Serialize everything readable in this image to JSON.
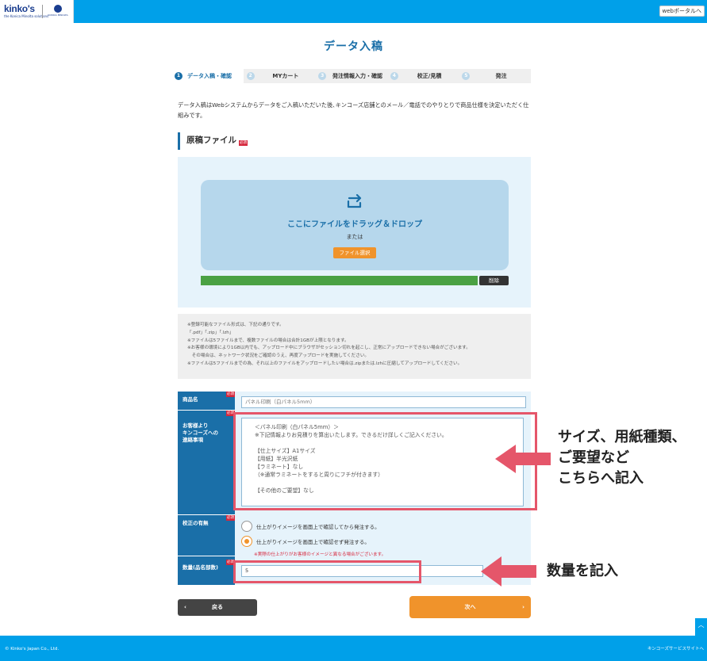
{
  "header": {
    "logo_text": "kinko's",
    "logo_sub": "the Konica Minolta solutions",
    "logo_partner": "KONICA MINOLTA",
    "web_button": "webポータルへ"
  },
  "page_title": "データ入稿",
  "steps": [
    {
      "num": "1",
      "label": "データ入稿・確認"
    },
    {
      "num": "2",
      "label": "MYカート"
    },
    {
      "num": "3",
      "label": "発注情報入力・確認"
    },
    {
      "num": "4",
      "label": "校正/見積"
    },
    {
      "num": "5",
      "label": "発注"
    }
  ],
  "intro_text": "データ入稿はWebシステムからデータをご入稿いただいた後､キンコーズ店舗とのメール／電話でのやりとりで商品仕様を決定いただく仕組みです。",
  "section": {
    "title": "原稿ファイル",
    "required": "必須"
  },
  "upload": {
    "drop_text": "ここにファイルをドラッグ＆ドロップ",
    "or_text": "または",
    "file_button": "ファイル選択",
    "delete_button": "削除",
    "progress": 1.0
  },
  "notes": [
    "※登録可能なファイル形式は、下記の通りです。",
    "「.pdf」「.zip」「.lzh」",
    "※ファイルは5ファイルまで、複数ファイルの場合は合計1GBが上限となります。",
    "※お客様の環境により1GB以内でも、アップロード中にブラウザがセッション切れを起こし、正常にアップロードできない場合がございます。",
    "　その場合は、ネットワーク状況をご確認のうえ、再度アップロードを実施してください。",
    "※ファイルは5ファイルまでの為、それ以上のファイルをアップロードしたい場合は.zipまたは.lzhに圧縮してアップロードしてください。"
  ],
  "form": {
    "required": "必須",
    "product_label": "商品名",
    "product_value": "パネル印刷（白パネル5mm）",
    "contact_label": "お客様より\nキンコーズへの\n連絡事項",
    "contact_lines": [
      "＜パネル印刷（白パネル5mm）＞",
      "※下記情報よりお見積りを算出いたします。できるだけ詳しくご記入ください。",
      "",
      "【仕上サイズ】A1サイズ",
      "【用紙】半光沢紙",
      "【ラミネート】なし",
      "（※通常ラミネートをすると周りにフチが付きます）",
      "",
      "【その他のご要望】なし"
    ],
    "proof_label": "校正の有無",
    "proof_options": [
      "仕上がりイメージを画面上で確認してから発注する。",
      "仕上がりイメージを画面上で確認せず発注する。"
    ],
    "proof_selected": 1,
    "proof_warning": "※実際の仕上がりがお客様のイメージと異なる場合がございます。",
    "qty_label": "数量(品名部数)",
    "qty_value": "5"
  },
  "annotations": {
    "contact_note_lines": [
      "サイズ、用紙種類、",
      "ご要望など",
      "こちらへ記入"
    ],
    "qty_note": "数量を記入",
    "highlight_color": "#e5566a"
  },
  "buttons": {
    "back": "戻る",
    "next": "次へ"
  },
  "footer": {
    "copyright": "© Kinko's Japan Co., Ltd.",
    "site_link": "キンコーズサービスサイトへ"
  },
  "colors": {
    "brand_blue": "#00a0e9",
    "accent_orange": "#f0932b",
    "label_blue": "#1a6fa8"
  }
}
